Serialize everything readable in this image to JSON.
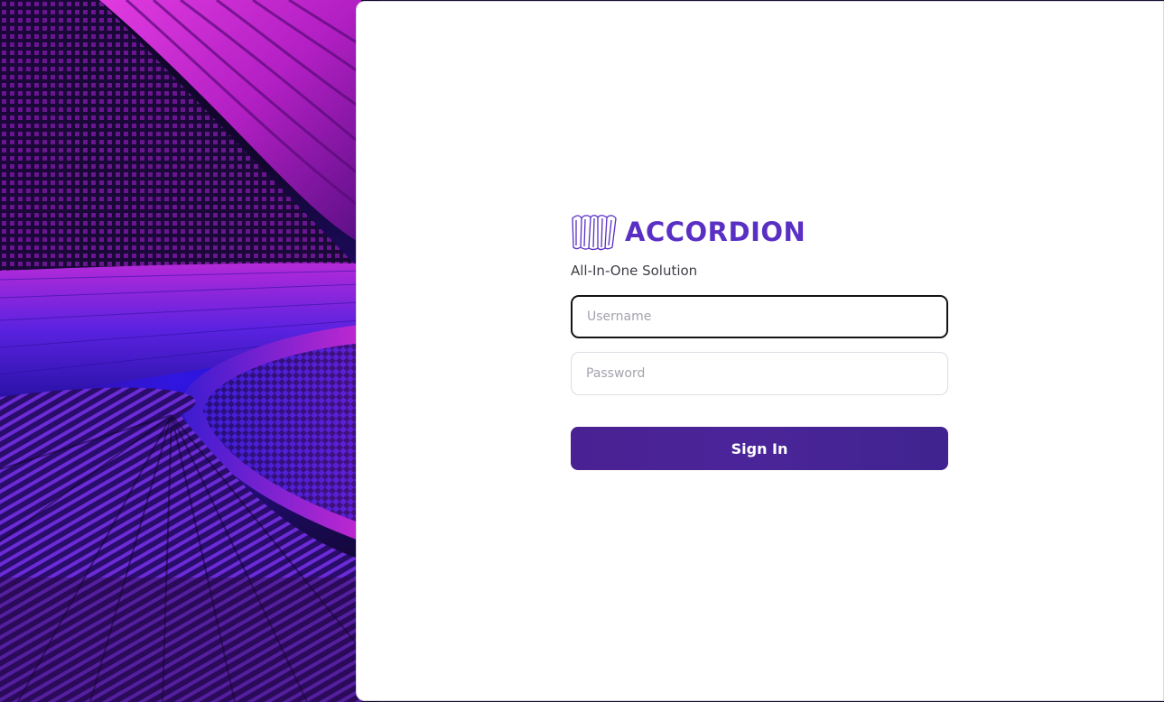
{
  "brand": {
    "name": "ACCORDION",
    "tagline": "All-In-One Solution",
    "logo_icon": "accordion-icon",
    "color": "#5a2fc4"
  },
  "login": {
    "username_placeholder": "Username",
    "username_value": "",
    "password_placeholder": "Password",
    "password_value": "",
    "submit_label": "Sign In",
    "button_color": "#4a2193"
  },
  "hero": {
    "image": "abstract-purple-3d-swirl",
    "colors": [
      "#a020c8",
      "#3b18d8",
      "#12062e"
    ]
  }
}
